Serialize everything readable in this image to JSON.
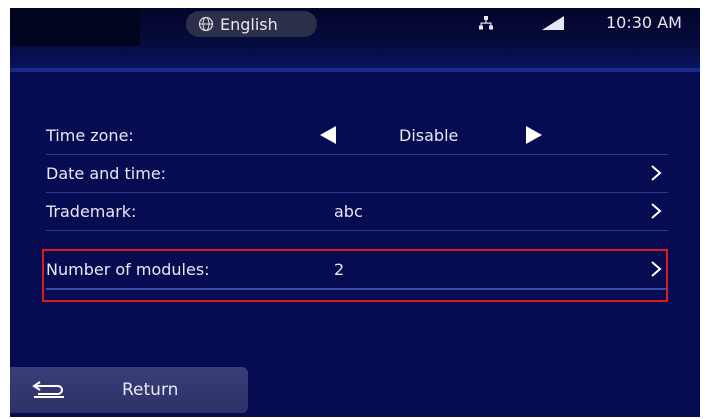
{
  "status_bar": {
    "language": "English",
    "time": "10:30 AM",
    "icons": [
      "globe-icon",
      "network-icon",
      "signal-icon"
    ]
  },
  "settings": {
    "time_zone": {
      "label": "Time zone:",
      "value": "Disable"
    },
    "date_time": {
      "label": "Date and time:"
    },
    "trademark": {
      "label": "Trademark:",
      "value": "abc"
    },
    "modules": {
      "label": "Number of modules:",
      "value": "2"
    }
  },
  "footer": {
    "return_label": "Return"
  },
  "colors": {
    "background": "#060b52",
    "highlight": "#e01a1a",
    "text": "#e8e8f0"
  }
}
